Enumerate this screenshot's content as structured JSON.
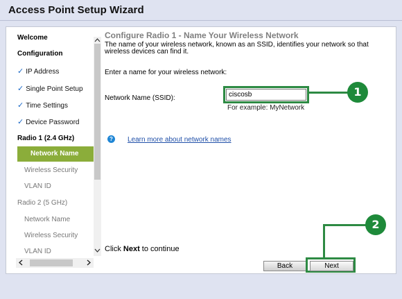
{
  "window": {
    "title": "Access Point Setup Wizard"
  },
  "sidebar": {
    "items": [
      {
        "label": "Welcome",
        "state": "section"
      },
      {
        "label": "Configuration",
        "state": "section"
      },
      {
        "label": "IP Address",
        "state": "done"
      },
      {
        "label": "Single Point Setup",
        "state": "done"
      },
      {
        "label": "Time Settings",
        "state": "done"
      },
      {
        "label": "Device Password",
        "state": "done"
      },
      {
        "label": "Radio 1 (2.4 GHz)",
        "state": "section"
      },
      {
        "label": "Network Name",
        "state": "active"
      },
      {
        "label": "Wireless Security",
        "state": "pending"
      },
      {
        "label": "VLAN ID",
        "state": "pending"
      },
      {
        "label": "Radio 2 (5 GHz)",
        "state": "pending-section"
      },
      {
        "label": "Network Name",
        "state": "pending"
      },
      {
        "label": "Wireless Security",
        "state": "pending"
      },
      {
        "label": "VLAN ID",
        "state": "pending"
      }
    ],
    "check_glyph": "✓"
  },
  "main": {
    "heading": "Configure Radio 1 - Name Your Wireless Network",
    "description": "The name of your wireless network, known as an SSID, identifies your network so that wireless devices can find it.",
    "prompt": "Enter a name for your wireless network:",
    "ssid": {
      "label": "Network Name (SSID):",
      "value": "ciscosb",
      "hint": "For example: MyNetwork"
    },
    "help": {
      "icon": "help-icon",
      "icon_glyph": "?",
      "link": "Learn more about network names"
    },
    "continue_prefix": "Click ",
    "continue_bold": "Next",
    "continue_suffix": " to continue",
    "buttons": {
      "back": "Back",
      "next": "Next"
    }
  },
  "callouts": {
    "one": "1",
    "two": "2"
  },
  "colors": {
    "accent_green": "#8bad3a",
    "callout_green": "#2d8a43",
    "link_blue": "#1f4fa8",
    "check_blue": "#1a68c7"
  }
}
